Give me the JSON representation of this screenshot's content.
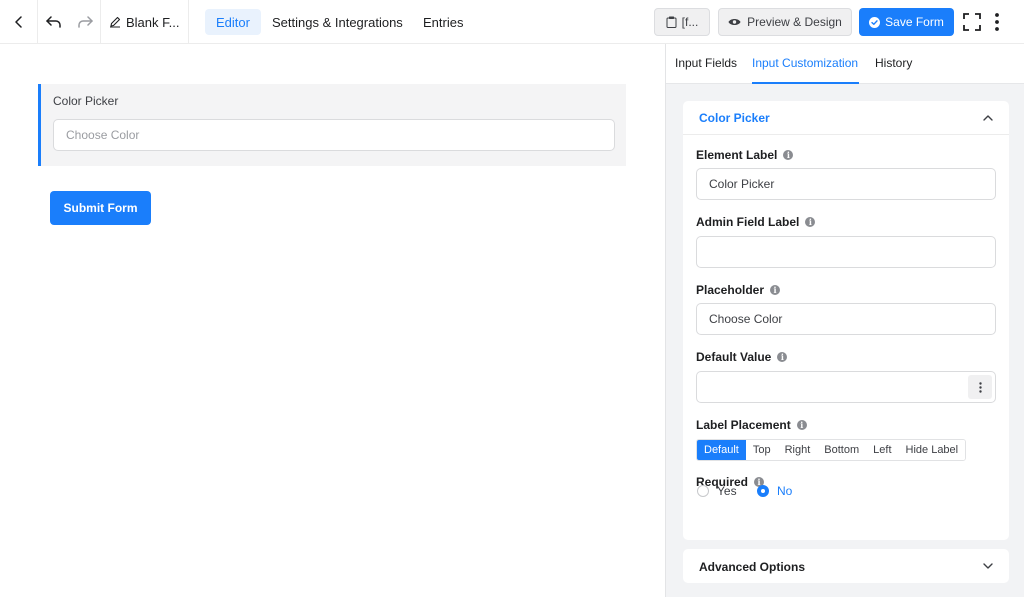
{
  "header": {
    "form_title": "Blank F...",
    "tabs": [
      "Editor",
      "Settings & Integrations",
      "Entries"
    ],
    "shortcode_label": "[f...",
    "preview_label": "Preview & Design",
    "save_label": "Save Form"
  },
  "editor": {
    "field_label": "Color Picker",
    "field_placeholder": "Choose Color",
    "submit_label": "Submit Form"
  },
  "panel": {
    "tabs": [
      "Input Fields",
      "Input Customization",
      "History"
    ],
    "active_tab": "Input Customization",
    "section_title": "Color Picker",
    "element_label": {
      "label": "Element Label",
      "value": "Color Picker"
    },
    "admin_label": {
      "label": "Admin Field Label",
      "value": ""
    },
    "placeholder": {
      "label": "Placeholder",
      "value": "Choose Color"
    },
    "default_value": {
      "label": "Default Value",
      "value": ""
    },
    "label_placement": {
      "label": "Label Placement",
      "options": [
        "Default",
        "Top",
        "Right",
        "Bottom",
        "Left",
        "Hide Label"
      ],
      "selected": "Default"
    },
    "required": {
      "label": "Required",
      "options": [
        "Yes",
        "No"
      ],
      "selected": "No"
    },
    "advanced_title": "Advanced Options"
  },
  "colors": {
    "accent": "#1a7efb",
    "panel_bg": "#f2f3f5"
  }
}
